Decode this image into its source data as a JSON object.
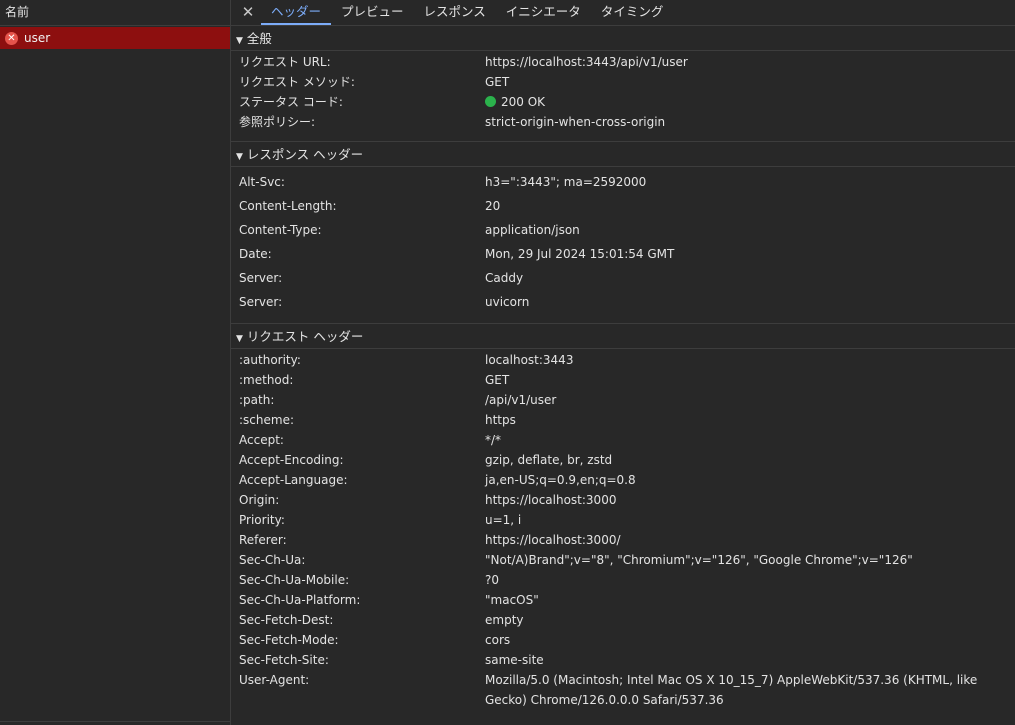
{
  "left_panel": {
    "header": "名前",
    "request_name": "user"
  },
  "tabs": [
    "ヘッダー",
    "プレビュー",
    "レスポンス",
    "イニシエータ",
    "タイミング"
  ],
  "active_tab": "ヘッダー",
  "general": {
    "title": "全般",
    "rows": [
      {
        "key": "リクエスト URL:",
        "value": "https://localhost:3443/api/v1/user"
      },
      {
        "key": "リクエスト メソッド:",
        "value": "GET"
      },
      {
        "key": "ステータス コード:",
        "value": "200 OK",
        "status_color": "#2bb24c"
      },
      {
        "key": "参照ポリシー:",
        "value": "strict-origin-when-cross-origin"
      }
    ]
  },
  "response_headers": {
    "title": "レスポンス ヘッダー",
    "rows": [
      {
        "key": "Alt-Svc:",
        "value": "h3=\":3443\"; ma=2592000"
      },
      {
        "key": "Content-Length:",
        "value": "20"
      },
      {
        "key": "Content-Type:",
        "value": "application/json"
      },
      {
        "key": "Date:",
        "value": "Mon, 29 Jul 2024 15:01:54 GMT"
      },
      {
        "key": "Server:",
        "value": "Caddy"
      },
      {
        "key": "Server:",
        "value": "uvicorn"
      }
    ]
  },
  "request_headers": {
    "title": "リクエスト ヘッダー",
    "rows": [
      {
        "key": ":authority:",
        "value": "localhost:3443"
      },
      {
        "key": ":method:",
        "value": "GET"
      },
      {
        "key": ":path:",
        "value": "/api/v1/user"
      },
      {
        "key": ":scheme:",
        "value": "https"
      },
      {
        "key": "Accept:",
        "value": "*/*"
      },
      {
        "key": "Accept-Encoding:",
        "value": "gzip, deflate, br, zstd"
      },
      {
        "key": "Accept-Language:",
        "value": "ja,en-US;q=0.9,en;q=0.8"
      },
      {
        "key": "Origin:",
        "value": "https://localhost:3000"
      },
      {
        "key": "Priority:",
        "value": "u=1, i"
      },
      {
        "key": "Referer:",
        "value": "https://localhost:3000/"
      },
      {
        "key": "Sec-Ch-Ua:",
        "value": "\"Not/A)Brand\";v=\"8\", \"Chromium\";v=\"126\", \"Google Chrome\";v=\"126\""
      },
      {
        "key": "Sec-Ch-Ua-Mobile:",
        "value": "?0"
      },
      {
        "key": "Sec-Ch-Ua-Platform:",
        "value": "\"macOS\""
      },
      {
        "key": "Sec-Fetch-Dest:",
        "value": "empty"
      },
      {
        "key": "Sec-Fetch-Mode:",
        "value": "cors"
      },
      {
        "key": "Sec-Fetch-Site:",
        "value": "same-site"
      },
      {
        "key": "User-Agent:",
        "value": "Mozilla/5.0 (Macintosh; Intel Mac OS X 10_15_7) AppleWebKit/537.36 (KHTML, like Gecko) Chrome/126.0.0.0 Safari/537.36"
      }
    ]
  },
  "colors": {
    "error_row": "#8d0f0f",
    "active_tab": "#7cacf8",
    "status_ok": "#2bb24c"
  }
}
